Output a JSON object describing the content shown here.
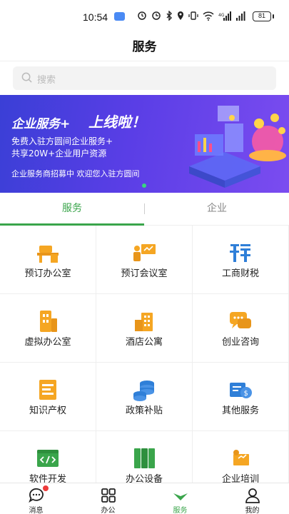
{
  "status_bar": {
    "time": "10:54",
    "battery": "81"
  },
  "header": {
    "title": "服务"
  },
  "search": {
    "placeholder": "搜索"
  },
  "banner": {
    "headline": "企业服务+",
    "headline_accent": "上线啦！",
    "line1": "免费入驻方圆间企业服务+",
    "line2": "共享20W+企业用户资源",
    "line3": "企业服务商招募中 欢迎您入驻方圆间"
  },
  "tabs": [
    {
      "label": "服务",
      "active": true
    },
    {
      "label": "企业",
      "active": false
    }
  ],
  "services": [
    {
      "label": "预订办公室",
      "icon": "office-desk-icon"
    },
    {
      "label": "预订会议室",
      "icon": "meeting-presentation-icon"
    },
    {
      "label": "工商财税",
      "icon": "tax-icon"
    },
    {
      "label": "虚拟办公室",
      "icon": "virtual-office-icon"
    },
    {
      "label": "酒店公寓",
      "icon": "hotel-building-icon"
    },
    {
      "label": "创业咨询",
      "icon": "chat-bubbles-icon"
    },
    {
      "label": "知识产权",
      "icon": "ip-certificate-icon"
    },
    {
      "label": "政策补贴",
      "icon": "coin-stack-icon"
    },
    {
      "label": "其他服务",
      "icon": "money-icon"
    },
    {
      "label": "软件开发",
      "icon": "code-icon"
    },
    {
      "label": "办公设备",
      "icon": "cabinet-icon"
    },
    {
      "label": "企业培训",
      "icon": "training-icon"
    }
  ],
  "bottom_nav": [
    {
      "label": "消息",
      "icon": "message-icon",
      "active": false
    },
    {
      "label": "办公",
      "icon": "grid-icon",
      "active": false
    },
    {
      "label": "服务",
      "icon": "service-icon",
      "active": true
    },
    {
      "label": "我的",
      "icon": "person-icon",
      "active": false
    }
  ],
  "colors": {
    "accent": "#3aa54b",
    "icon_orange": "#f5a623",
    "icon_blue": "#2f7fd8",
    "icon_green": "#3aa54b",
    "banner_start": "#3a3fd6",
    "banner_end": "#7b4cf0"
  }
}
